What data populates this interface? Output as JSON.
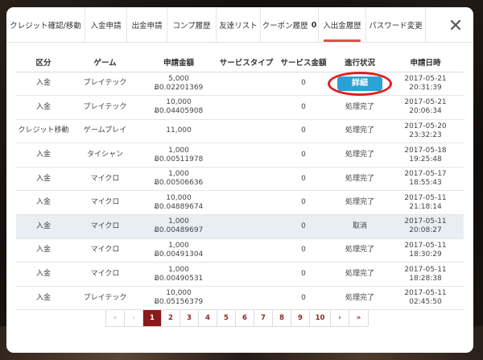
{
  "tabs": [
    {
      "label": "クレジット確認/移動"
    },
    {
      "label": "入金申請"
    },
    {
      "label": "出金申請"
    },
    {
      "label": "コンプ履歴"
    },
    {
      "label": "友達リスト"
    },
    {
      "label": "クーポン履歴",
      "badge": "0"
    },
    {
      "label": "入出金履歴",
      "active": true
    },
    {
      "label": "パスワード変更"
    }
  ],
  "close_symbol": "✕",
  "table": {
    "headers": [
      "区分",
      "ゲーム",
      "申請金額",
      "サービスタイプ",
      "サービス金額",
      "進行状況",
      "申請日時"
    ],
    "rows": [
      {
        "type": "入金",
        "game": "プレイテック",
        "amount": "5,000",
        "btc": "Ƀ0.02201369",
        "service_type": "",
        "service_amount": "0",
        "status": "詳細",
        "date": "2017-05-21 20:31:39"
      },
      {
        "type": "入金",
        "game": "プレイテック",
        "amount": "10,000",
        "btc": "Ƀ0.04405908",
        "service_type": "",
        "service_amount": "0",
        "status": "処理完了",
        "date": "2017-05-21 20:06:34"
      },
      {
        "type": "クレジット移動",
        "game": "ゲームプレイ",
        "amount": "11,000",
        "btc": "",
        "service_type": "",
        "service_amount": "0",
        "status": "処理完了",
        "date": "2017-05-20 23:32:23"
      },
      {
        "type": "入金",
        "game": "タイシャン",
        "amount": "1,000",
        "btc": "Ƀ0.00511978",
        "service_type": "",
        "service_amount": "0",
        "status": "処理完了",
        "date": "2017-05-18 19:25:48"
      },
      {
        "type": "入金",
        "game": "マイクロ",
        "amount": "1,000",
        "btc": "Ƀ0.00506636",
        "service_type": "",
        "service_amount": "0",
        "status": "処理完了",
        "date": "2017-05-17 18:55:43"
      },
      {
        "type": "入金",
        "game": "マイクロ",
        "amount": "10,000",
        "btc": "Ƀ0.04889674",
        "service_type": "",
        "service_amount": "0",
        "status": "処理完了",
        "date": "2017-05-11 21:18:14"
      },
      {
        "type": "入金",
        "game": "マイクロ",
        "amount": "1,000",
        "btc": "Ƀ0.00489697",
        "service_type": "",
        "service_amount": "0",
        "status": "取消",
        "date": "2017-05-11 20:08:27",
        "highlight": true
      },
      {
        "type": "入金",
        "game": "マイクロ",
        "amount": "1,000",
        "btc": "Ƀ0.00491304",
        "service_type": "",
        "service_amount": "0",
        "status": "処理完了",
        "date": "2017-05-11 18:30:29"
      },
      {
        "type": "入金",
        "game": "マイクロ",
        "amount": "1,000",
        "btc": "Ƀ0.00490531",
        "service_type": "",
        "service_amount": "0",
        "status": "処理完了",
        "date": "2017-05-11 18:28:38"
      },
      {
        "type": "入金",
        "game": "プレイテック",
        "amount": "10,000",
        "btc": "Ƀ0.05156379",
        "service_type": "",
        "service_amount": "0",
        "status": "処理完了",
        "date": "2017-05-11 02:45:50"
      }
    ]
  },
  "pagination": {
    "first": "«",
    "prev": "‹",
    "pages": [
      "1",
      "2",
      "3",
      "4",
      "5",
      "6",
      "7",
      "8",
      "9",
      "10"
    ],
    "current": "1",
    "next": "›",
    "last": "»"
  },
  "colors": {
    "tab_active_underline": "#d9534f",
    "detail_button": "#2aa2d6",
    "highlight_ring": "#e41e1e",
    "pager_active": "#8b1a1a",
    "row_highlight": "#e8eef3"
  }
}
